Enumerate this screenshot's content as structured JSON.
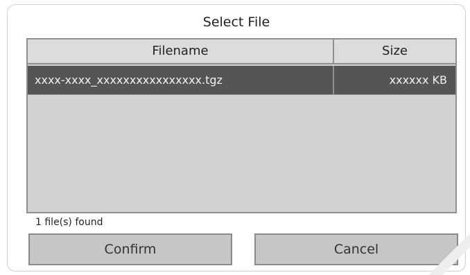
{
  "dialog": {
    "title": "Select File"
  },
  "table": {
    "columns": [
      "Filename",
      "Size"
    ],
    "rows": [
      {
        "filename": "xxxx-xxxx_xxxxxxxxxxxxxxxx.tgz",
        "size": "xxxxxx KB"
      }
    ]
  },
  "status": "1 file(s) found",
  "buttons": {
    "confirm_label": "Confirm",
    "cancel_label": "Cancel"
  },
  "colors": {
    "selected_row": "#555555",
    "table_background": "#d3d3d3",
    "button_background": "#c6c6c6"
  }
}
